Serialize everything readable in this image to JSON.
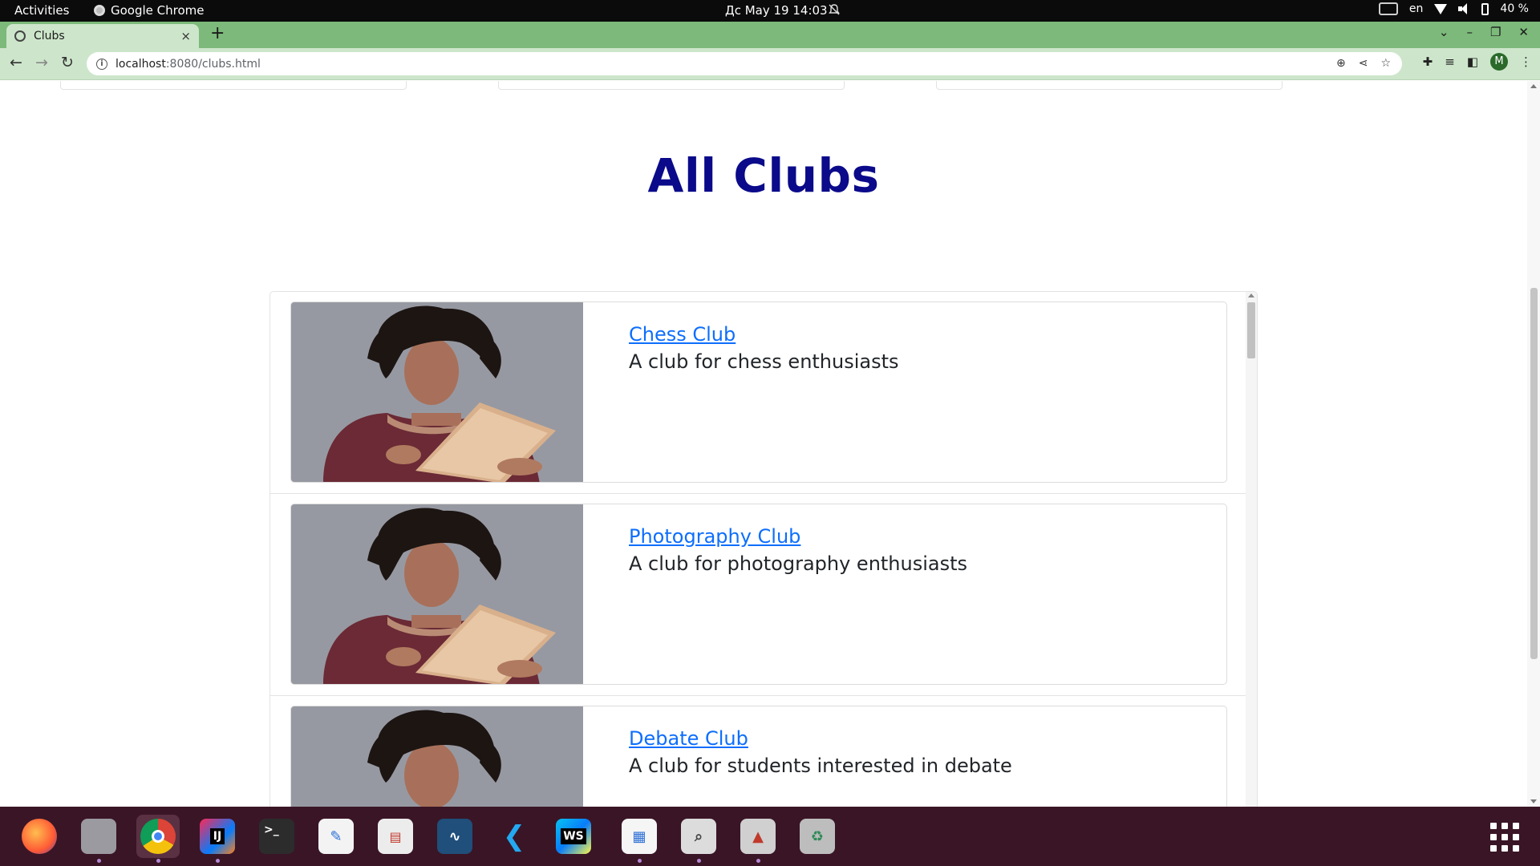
{
  "system_bar": {
    "activities": "Activities",
    "app_name": "Google Chrome",
    "clock": "Дс May 19  14:03",
    "language": "en",
    "battery": "40 %"
  },
  "browser": {
    "tab_title": "Clubs",
    "tab_close": "×",
    "new_tab": "+",
    "url_host": "localhost",
    "url_path": ":8080/clubs.html",
    "profile_initial": "M"
  },
  "page": {
    "heading": "All Clubs",
    "clubs": [
      {
        "name": "Chess Club",
        "description": "A club for chess enthusiasts"
      },
      {
        "name": "Photography Club",
        "description": "A club for photography enthusiasts"
      },
      {
        "name": "Debate Club",
        "description": "A club for students interested in debate"
      }
    ]
  },
  "dock": {
    "apps": [
      "firefox-icon",
      "files-icon",
      "chrome-icon",
      "intellij-icon",
      "terminal-icon",
      "text-editor-icon",
      "document-viewer-icon",
      "mysql-workbench-icon",
      "vscode-icon",
      "webstorm-icon",
      "writer-icon",
      "image-viewer-icon",
      "java-app-icon",
      "trash-icon"
    ],
    "terminal_label": ">_",
    "intellij_label": "IJ",
    "webstorm_label": "WS"
  },
  "colors": {
    "heading": "#0a0a8a",
    "link": "#0d6efd",
    "tabstrip": "#7cb97a",
    "toolbar": "#cde6cb",
    "dock": "#3a1526"
  }
}
